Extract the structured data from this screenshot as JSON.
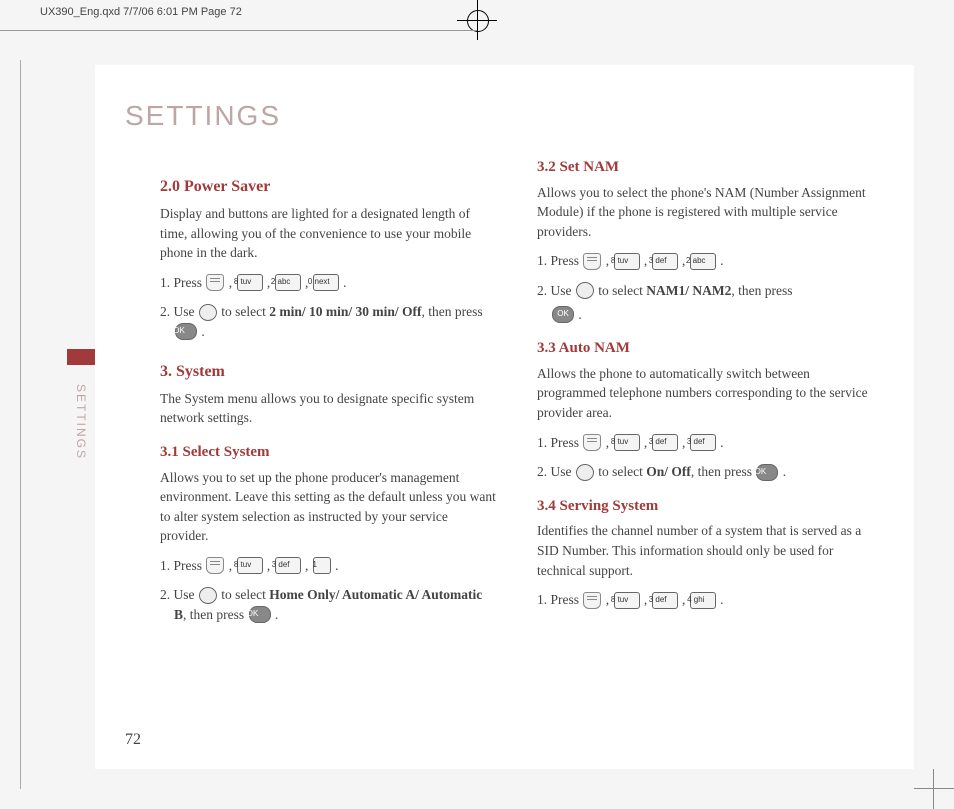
{
  "doc_header": "UX390_Eng.qxd  7/7/06  6:01 PM  Page 72",
  "page_title": "SETTINGS",
  "side_label": "SETTINGS",
  "page_number": "72",
  "left": {
    "s20_h": "2.0 Power Saver",
    "s20_p": "Display and buttons are lighted for a designated length of time, allowing you of the convenience to use your mobile phone in the dark.",
    "s20_step1_a": "1. Press ",
    "s20_step2_a": "2. Use ",
    "s20_step2_b": " to select ",
    "s20_step2_c": "2 min/ 10 min/ 30 min/ Off",
    "s20_step2_d": ", then press ",
    "s3_h": "3. System",
    "s3_p": "The System menu allows you to designate specific system network settings.",
    "s31_h": "3.1 Select System",
    "s31_p": "Allows you to set up the phone producer's management environment. Leave this setting as the default unless you want to alter system selection as instructed by your service provider.",
    "s31_step1_a": "1. Press ",
    "s31_step2_a": "2. Use ",
    "s31_step2_b": " to select ",
    "s31_step2_c": "Home Only/ Automatic A/ Automatic B",
    "s31_step2_d": ", then press "
  },
  "right": {
    "s32_h": "3.2 Set NAM",
    "s32_p": "Allows you to select the phone's NAM (Number Assignment Module) if the phone is registered with multiple service providers.",
    "s32_step1_a": "1. Press ",
    "s32_step2_a": "2. Use ",
    "s32_step2_b": " to select ",
    "s32_step2_c": "NAM1/ NAM2",
    "s32_step2_d": ", then press ",
    "s33_h": "3.3 Auto NAM",
    "s33_p": "Allows the phone to automatically switch between programmed telephone numbers corresponding to the service provider area.",
    "s33_step1_a": "1. Press ",
    "s33_step2_a": "2. Use ",
    "s33_step2_b": " to select ",
    "s33_step2_c": "On/ Off",
    "s33_step2_d": ", then press ",
    "s34_h": "3.4 Serving System",
    "s34_p": "Identifies the channel number of a system that is served as a SID Number. This information should only be used for technical support.",
    "s34_step1_a": "1. Press "
  },
  "keys": {
    "k8": "8 tuv",
    "k2": "2 abc",
    "k0": "0 next",
    "k3": "3 def",
    "k1": "1",
    "k4": "4 ghi",
    "ok": "OK"
  }
}
